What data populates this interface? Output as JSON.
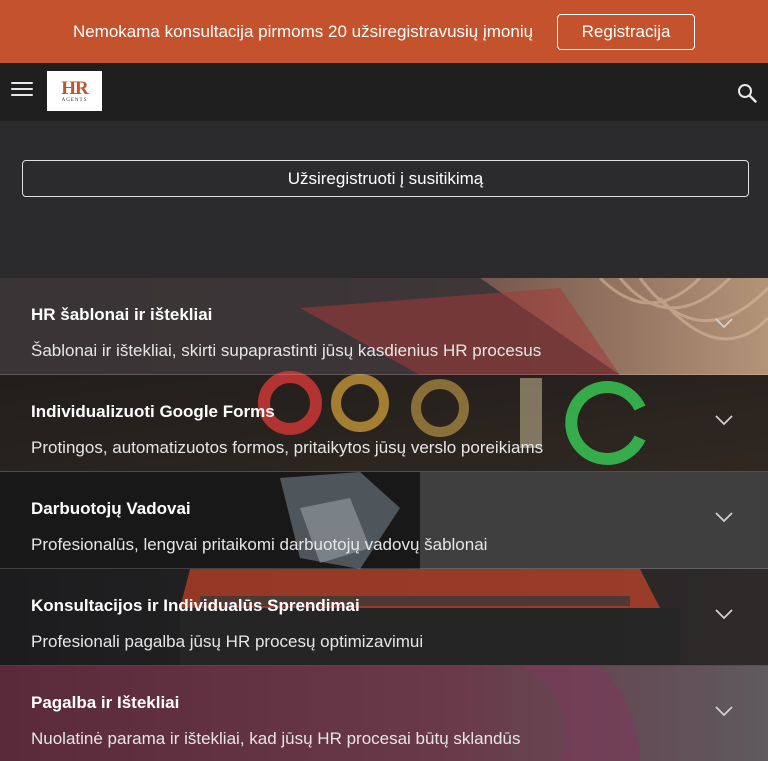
{
  "promo": {
    "text": "Nemokama konsultacija pirmoms 20 užsiregistravusių įmonių",
    "button_label": "Registracija"
  },
  "header": {
    "logo_mark": "HR",
    "logo_sub": "AGENTS",
    "menu_icon": "hamburger-menu-icon",
    "search_icon": "search-icon"
  },
  "hero": {
    "cta_label": "Užsiregistruoti į susitikimą"
  },
  "accordion": {
    "items": [
      {
        "title": "HR šablonai ir ištekliai",
        "description": "Šablonai ir ištekliai, skirti supaprastinti jūsų kasdienius HR procesus"
      },
      {
        "title": "Individualizuoti Google Forms",
        "description": "Protingos, automatizuotos formos, pritaikytos jūsų verslo poreikiams"
      },
      {
        "title": "Darbuotojų Vadovai",
        "description": "Profesionalūs, lengvai pritaikomi darbuotojų vadovų šablonai"
      },
      {
        "title": "Konsultacijos ir Individualūs Sprendimai",
        "description": "Profesionali pagalba jūsų HR procesų optimizavimui"
      },
      {
        "title": "Pagalba ir Ištekliai",
        "description": "Nuolatinė parama ir ištekliai, kad jūsų HR procesai būtų sklandūs"
      }
    ]
  },
  "colors": {
    "promo_bg": "#c4522c",
    "header_bg": "#1f1f1f",
    "page_bg": "#2b2b2d"
  }
}
